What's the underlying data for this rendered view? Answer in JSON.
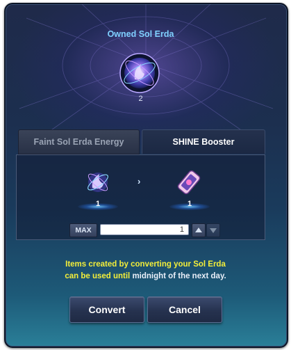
{
  "owned": {
    "title": "Owned Sol Erda",
    "count": "2"
  },
  "tabs": [
    {
      "label": "Faint Sol Erda Energy",
      "selected": false
    },
    {
      "label": "SHINE Booster",
      "selected": true
    }
  ],
  "conversion": {
    "input_qty": "1",
    "output_qty": "1",
    "arrow": "›"
  },
  "quantity_control": {
    "max_label": "MAX",
    "value": "1"
  },
  "notice": {
    "highlight_1": "Items created by converting your Sol Erda",
    "highlight_2": "can be used until",
    "rest": " midnight of the next day."
  },
  "buttons": {
    "convert": "Convert",
    "cancel": "Cancel"
  },
  "colors": {
    "title": "#7fd0ff",
    "highlight": "#f3ee3a",
    "accent_glow": "#6ec8ff"
  }
}
